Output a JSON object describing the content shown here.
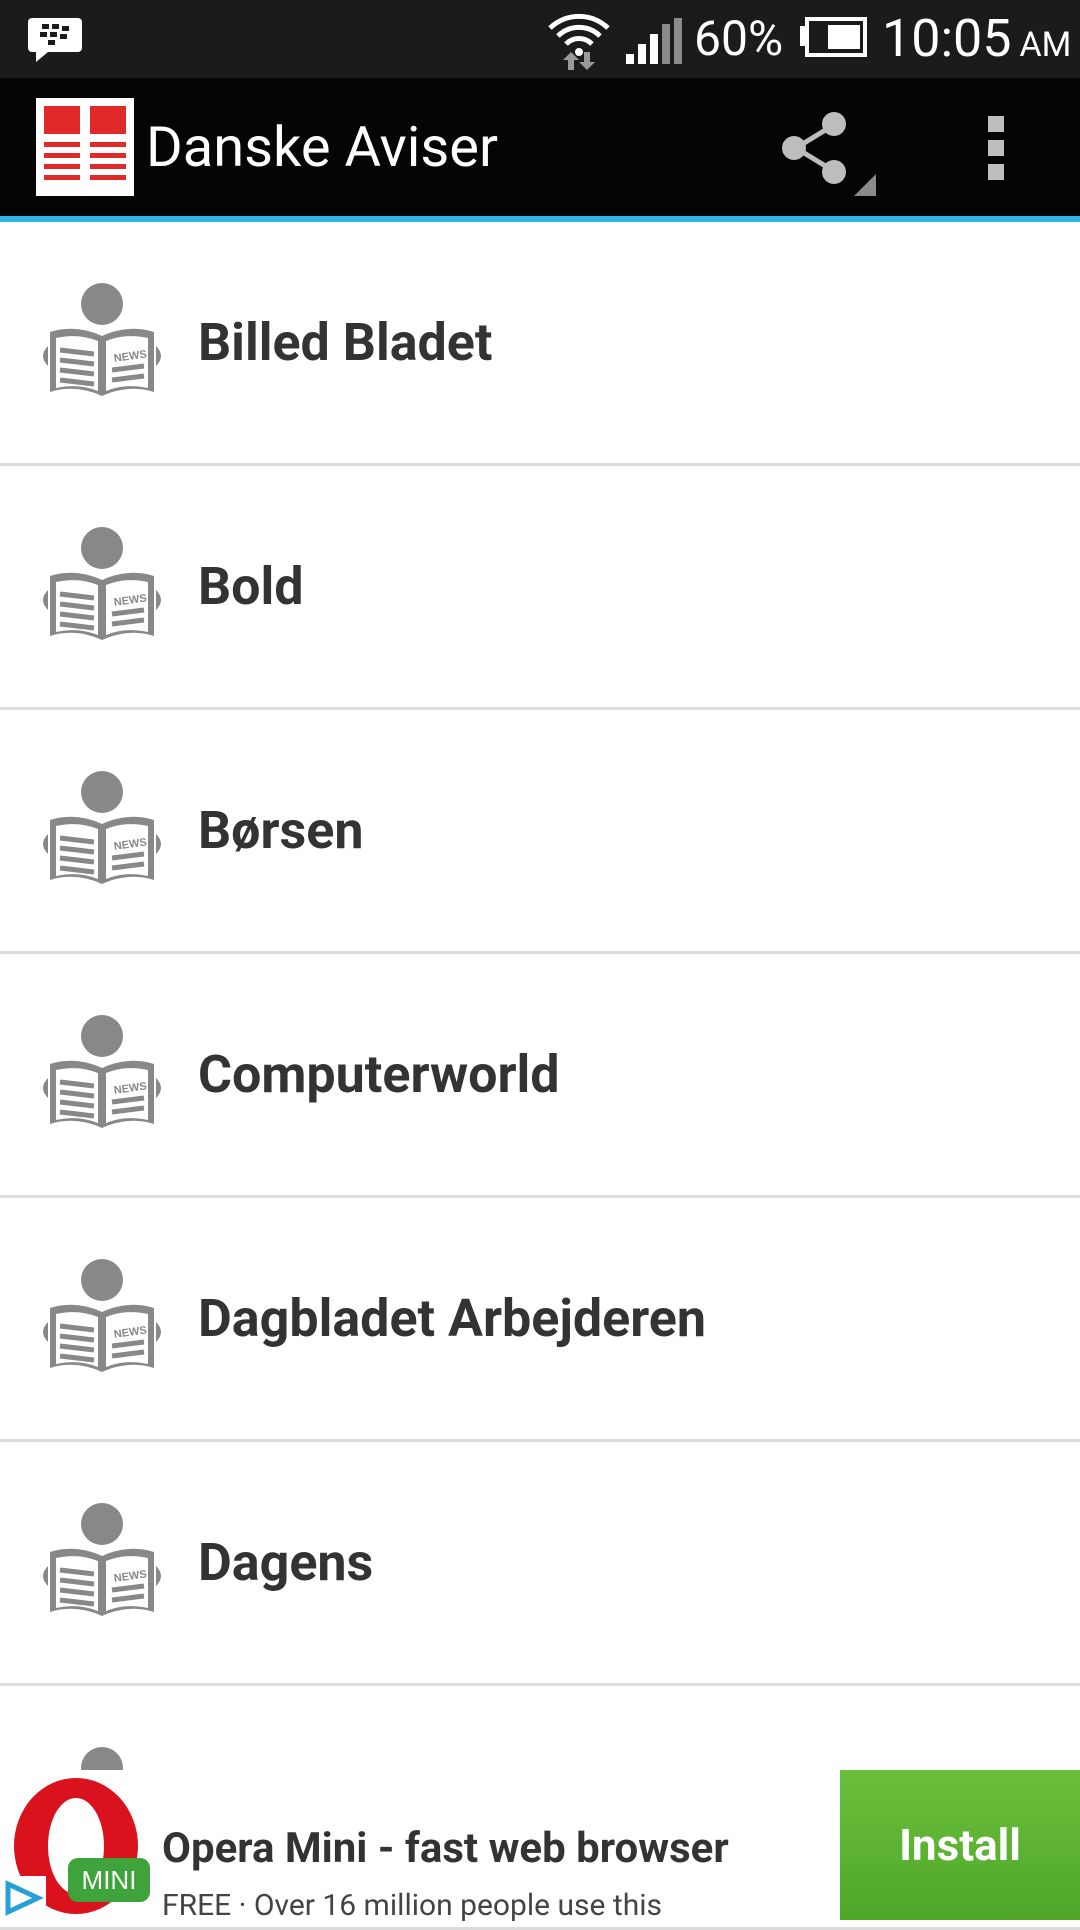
{
  "status_bar": {
    "battery_percent": "60%",
    "time": "10:05",
    "ampm": "AM"
  },
  "action_bar": {
    "title": "Danske Aviser",
    "accent_color": "#33b5e5",
    "icons": [
      "app-logo-icon",
      "share-icon",
      "overflow-menu-icon"
    ]
  },
  "list": {
    "items": [
      {
        "label": "Billed Bladet"
      },
      {
        "label": "Bold"
      },
      {
        "label": "Børsen"
      },
      {
        "label": "Computerworld"
      },
      {
        "label": "Dagbladet Arbejderen"
      },
      {
        "label": "Dagens"
      },
      {
        "label": ""
      }
    ]
  },
  "ad": {
    "title": "Opera Mini - fast web browser",
    "subtitle": "FREE · Over 16 million people use this",
    "logo_badge": "MINI",
    "install_label": "Install",
    "install_color": "#5ab532"
  }
}
